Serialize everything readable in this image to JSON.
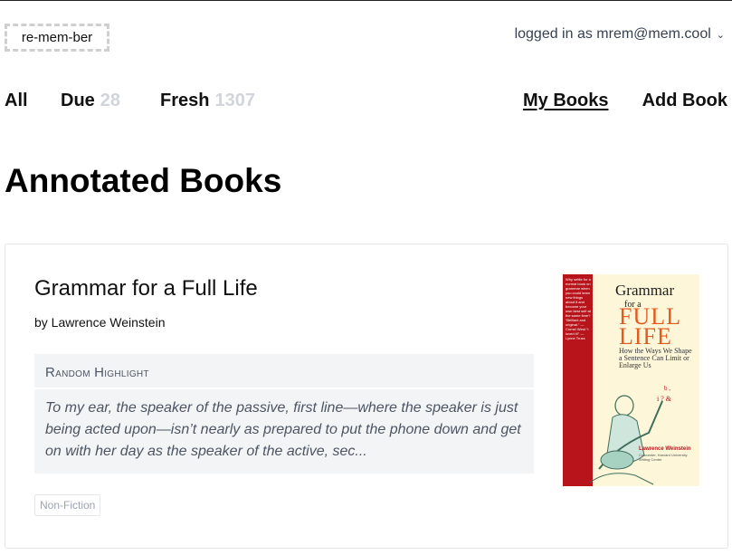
{
  "header": {
    "logo": "re-mem-ber",
    "user_menu": "logged in as mrem@mem.cool",
    "chevron_icon": "chevron-down-icon"
  },
  "nav": {
    "all": "All",
    "due": "Due",
    "due_count": "28",
    "fresh": "Fresh",
    "fresh_count": "1307",
    "my_books": "My Books",
    "add_book": "Add Book"
  },
  "page": {
    "title": "Annotated Books"
  },
  "books": [
    {
      "title": "Grammar for a Full Life",
      "author": "by Lawrence Weinstein",
      "highlight_label_first": "R",
      "highlight_label_rest": "andom",
      "highlight_label_first2": "H",
      "highlight_label_rest2": "ighlight",
      "highlight_text": "To my ear, the speaker of the passive, first line—where the speaker is just being acted upon—isn’t nearly as prepared to put the phone down and get on with her day as the speaker of the active, sec...",
      "tag": "Non-Fiction",
      "cover": {
        "title_line1": "Grammar",
        "title_line2": "for a",
        "title_big": "FULL LIFE",
        "subtitle": "How the Ways We Shape a Sentence Can Limit or Enlarge Us",
        "author": "Lawrence Weinstein",
        "affiliation": "Cofounder, Harvard University Writing Center",
        "spine_text": "Why settle for a normal book on grammar when you could learn new things about it and become your own best self at the same time? “Brilliant and original.” —Cornel West “I loved it!” —Lynne Truss",
        "colors": {
          "spine": "#b8141c",
          "background": "#fdf6d9",
          "accent": "#e15b1f"
        }
      }
    }
  ]
}
